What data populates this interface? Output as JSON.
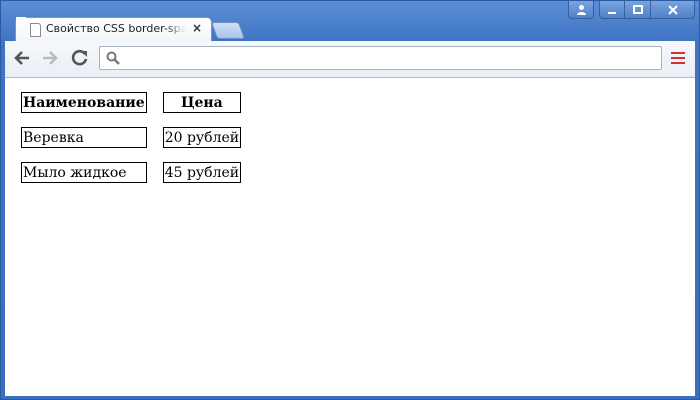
{
  "tab": {
    "title": "Свойство CSS border-spacing",
    "close_glyph": "×"
  },
  "window_controls": {
    "user_glyph": "👤",
    "minimize_glyph": "▁",
    "maximize_glyph": "▢",
    "close_glyph": "X"
  },
  "toolbar": {
    "back_glyph": "←",
    "forward_glyph": "→",
    "reload_glyph": "↻",
    "address_value": "",
    "address_placeholder": ""
  },
  "table": {
    "headers": [
      "Наименование",
      "Цена"
    ],
    "rows": [
      [
        "Веревка",
        "20 рублей"
      ],
      [
        "Мыло жидкое",
        "45 рублей"
      ]
    ]
  },
  "colors": {
    "frame": "#3f74c4",
    "menu_accent": "#d2322d"
  },
  "icons": [
    "page-icon",
    "close-icon",
    "user-icon",
    "minimize-icon",
    "maximize-icon",
    "window-close-icon",
    "back-arrow-icon",
    "forward-arrow-icon",
    "reload-icon",
    "search-icon",
    "menu-icon"
  ]
}
